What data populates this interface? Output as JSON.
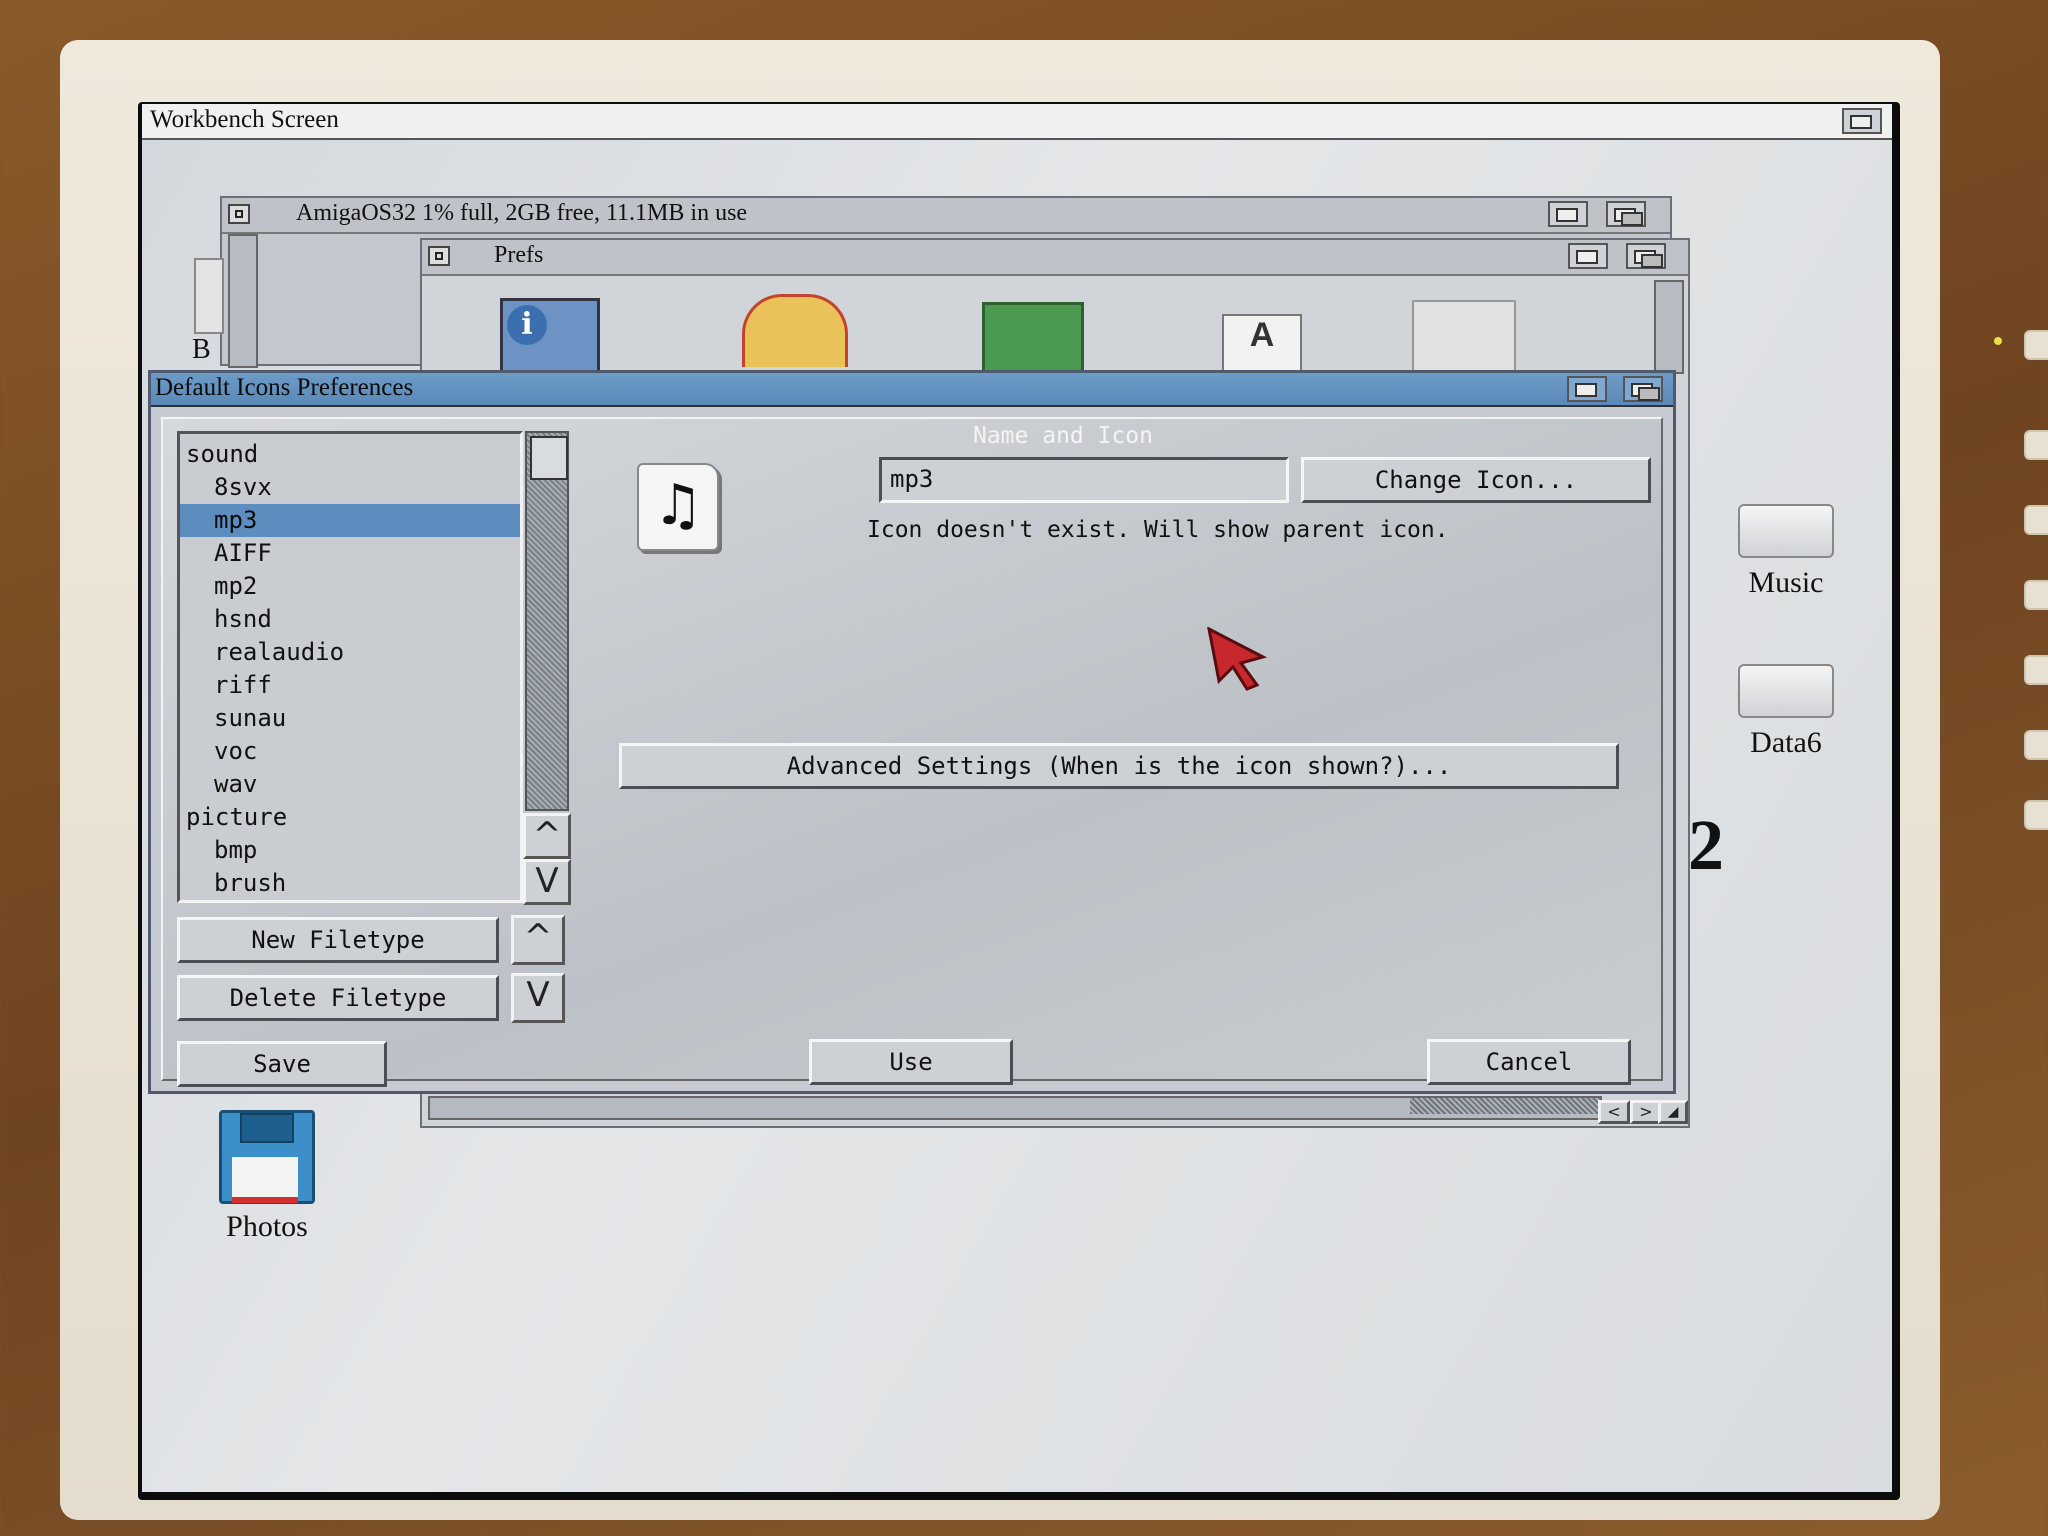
{
  "screen": {
    "title": "Workbench Screen"
  },
  "drive_window": {
    "title": "AmigaOS32  1% full, 2GB free, 11.1MB in use"
  },
  "prefs_drawer": {
    "title": "Prefs"
  },
  "default_icons_window": {
    "title": "Default Icons Preferences",
    "filetypes": [
      {
        "label": "sound",
        "level": 0
      },
      {
        "label": "8svx",
        "level": 1
      },
      {
        "label": "mp3",
        "level": 1,
        "selected": true
      },
      {
        "label": "AIFF",
        "level": 1
      },
      {
        "label": "mp2",
        "level": 1
      },
      {
        "label": "hsnd",
        "level": 1
      },
      {
        "label": "realaudio",
        "level": 1
      },
      {
        "label": "riff",
        "level": 1
      },
      {
        "label": "sunau",
        "level": 1
      },
      {
        "label": "voc",
        "level": 1
      },
      {
        "label": "wav",
        "level": 1
      },
      {
        "label": "picture",
        "level": 0
      },
      {
        "label": "bmp",
        "level": 1
      },
      {
        "label": "brush",
        "level": 1
      }
    ],
    "new_filetype_label": "New Filetype",
    "delete_filetype_label": "Delete Filetype",
    "save_label": "Save",
    "section_title": "Name and Icon",
    "name_value": "mp3",
    "change_icon_label": "Change Icon...",
    "icon_status": "Icon doesn't exist. Will show parent icon.",
    "advanced_label": "Advanced Settings (When is the icon shown?)...",
    "use_label": "Use",
    "cancel_label": "Cancel",
    "up_arrow": "^",
    "down_arrow": "V"
  },
  "desktop_icons": [
    {
      "label": "Music",
      "icon": "harddisk-icon"
    },
    {
      "label": "Data6",
      "icon": "harddisk-icon"
    },
    {
      "label": "Photos",
      "icon": "floppy-icon"
    }
  ],
  "partial_label": "2",
  "colors": {
    "title_bar_active": "#6d9cc8",
    "selection": "#5d8cbf",
    "workbench_bg": "#d9dcdf"
  }
}
